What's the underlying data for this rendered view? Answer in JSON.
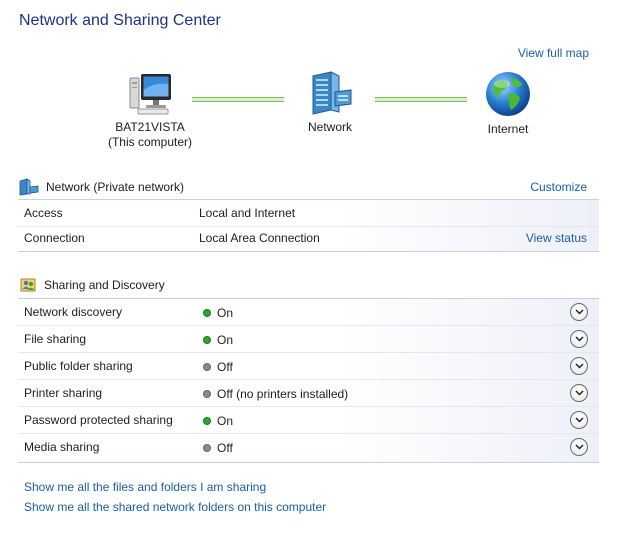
{
  "window": {
    "title": "Network and Sharing Center"
  },
  "map": {
    "view_full_map": "View full map",
    "computer": {
      "name": "BAT21VISTA",
      "subtitle": "(This computer)",
      "icon": "computer-icon"
    },
    "network": {
      "name": "Network",
      "icon": "network-icon"
    },
    "internet": {
      "name": "Internet",
      "icon": "globe-icon"
    }
  },
  "network_section": {
    "title": "Network (Private network)",
    "customize": "Customize",
    "icon": "network-small-icon",
    "rows": [
      {
        "label": "Access",
        "value": "Local and Internet",
        "action": ""
      },
      {
        "label": "Connection",
        "value": "Local Area Connection",
        "action": "View status"
      }
    ]
  },
  "sharing_section": {
    "title": "Sharing and Discovery",
    "icon": "sharing-icon",
    "rows": [
      {
        "label": "Network discovery",
        "status": "On",
        "state": "on"
      },
      {
        "label": "File sharing",
        "status": "On",
        "state": "on"
      },
      {
        "label": "Public folder sharing",
        "status": "Off",
        "state": "off"
      },
      {
        "label": "Printer sharing",
        "status": "Off (no printers installed)",
        "state": "off"
      },
      {
        "label": "Password protected sharing",
        "status": "On",
        "state": "on"
      },
      {
        "label": "Media sharing",
        "status": "Off",
        "state": "off"
      }
    ]
  },
  "links": {
    "files_folders": "Show me all the files and folders I am sharing",
    "shared_folders": "Show me all the shared network folders on this computer"
  },
  "colors": {
    "title": "#1e3287",
    "link": "#1a5fa8",
    "on_dot": "#2ea52e",
    "off_dot": "#8a8a8a",
    "connector": "#7fbf5a"
  }
}
